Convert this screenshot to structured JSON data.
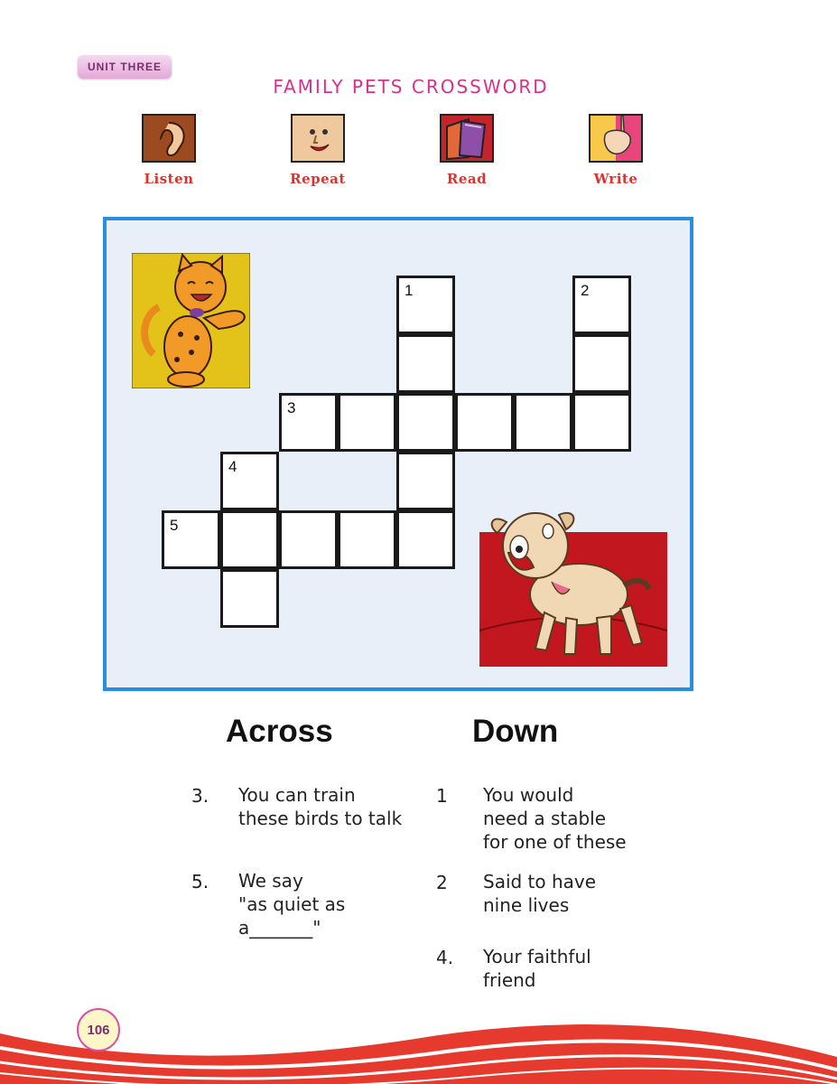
{
  "header": {
    "unit_label": "UNIT THREE",
    "title": "FAMILY PETS CROSSWORD"
  },
  "skills": [
    {
      "label": "Listen",
      "icon": "ear-icon"
    },
    {
      "label": "Repeat",
      "icon": "talking-face-icon"
    },
    {
      "label": "Read",
      "icon": "book-icon"
    },
    {
      "label": "Write",
      "icon": "hand-pencil-icon"
    }
  ],
  "crossword": {
    "numbers": [
      "1",
      "2",
      "3",
      "4",
      "5"
    ],
    "illustrations": [
      "cat-illustration",
      "dog-illustration"
    ]
  },
  "clues": {
    "across_heading": "Across",
    "down_heading": "Down",
    "across": [
      {
        "num": "3.",
        "text": "You can train\nthese birds to talk"
      },
      {
        "num": "5.",
        "text": "We say\n\"as quiet as\na_______\""
      }
    ],
    "down": [
      {
        "num": "1",
        "text": "You would\nneed a stable\nfor one of these"
      },
      {
        "num": "2",
        "text": "Said to have\nnine lives"
      },
      {
        "num": "4.",
        "text": "Your faithful\nfriend"
      }
    ]
  },
  "footer": {
    "page_number": "106"
  },
  "colors": {
    "accent_pink": "#d92f8f",
    "skill_red": "#e0312e",
    "frame_blue": "#2a8ee0",
    "wave_red": "#e63a2f"
  }
}
